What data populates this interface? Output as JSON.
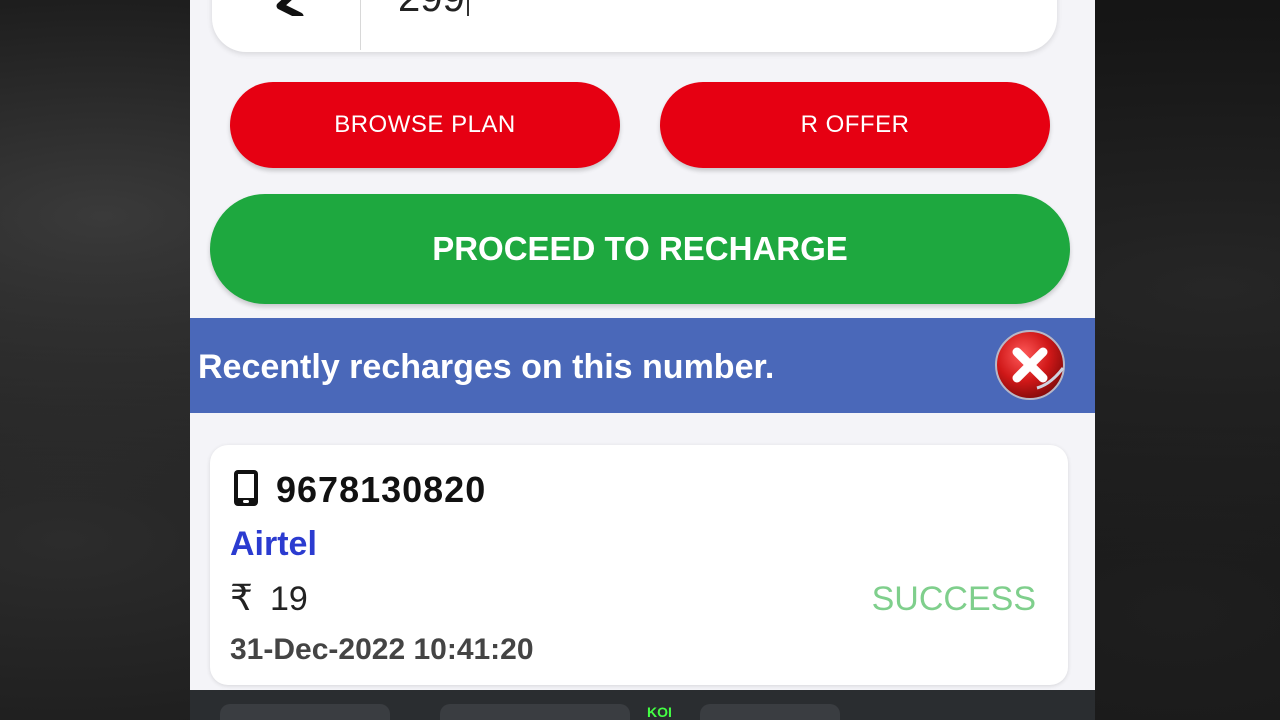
{
  "amount_input": {
    "value": "299"
  },
  "buttons": {
    "browse_plan": "BROWSE PLAN",
    "r_offer": "R OFFER",
    "proceed": "PROCEED TO RECHARGE"
  },
  "recent": {
    "title": "Recently recharges on this number.",
    "items": [
      {
        "number": "9678130820",
        "operator": "Airtel",
        "currency_symbol": "₹",
        "amount": "19",
        "status": "SUCCESS",
        "datetime": "31-Dec-2022 10:41:20"
      }
    ]
  },
  "overlay": {
    "watermark": "KOI"
  },
  "colors": {
    "red_button": "#e60012",
    "green_button": "#1ea83f",
    "header_blue": "#4a68b9",
    "operator_blue": "#2b3bd0",
    "status_green": "#7fcf8c"
  },
  "icons": {
    "back": "chevron-left-icon",
    "close": "close-icon",
    "phone": "mobile-phone-icon",
    "currency": "rupee-icon"
  }
}
